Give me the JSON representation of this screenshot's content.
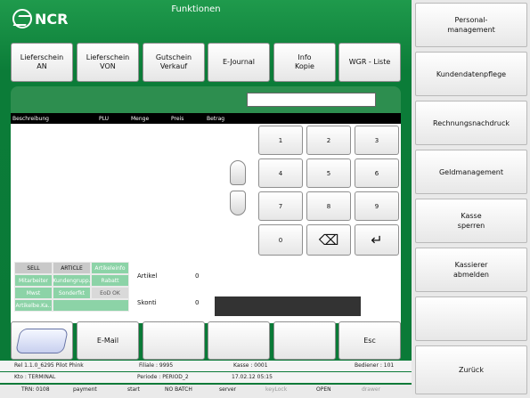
{
  "brand": "NCR",
  "title": "Funktionen",
  "function_buttons": [
    {
      "label": "Lieferschein\nAN"
    },
    {
      "label": "Lieferschein\nVON"
    },
    {
      "label": "Gutschein\nVerkauf"
    },
    {
      "label": "E-Journal"
    },
    {
      "label": "Info\nKopie"
    },
    {
      "label": "WGR - Liste"
    }
  ],
  "right_buttons": [
    {
      "label": "Personal-\nmanagement"
    },
    {
      "label": "Kundendatenpflege"
    },
    {
      "label": "Rechnungsnachdruck"
    },
    {
      "label": "Geldmanagement"
    },
    {
      "label": "Kasse\nsperren"
    },
    {
      "label": "Kassierer\nabmelden"
    },
    {
      "label": ""
    },
    {
      "label": "Zurück"
    }
  ],
  "input": {
    "value": ""
  },
  "columns": [
    "Beschreibung",
    "PLU",
    "Menge",
    "Preis",
    "Betrag"
  ],
  "numpad": [
    "1",
    "2",
    "3",
    "4",
    "5",
    "6",
    "7",
    "8",
    "9",
    "0",
    "⌫",
    "↵"
  ],
  "quick_buttons": [
    "SELL",
    "ARTICLE",
    "Artikeleinfo",
    "Mitarbeiter",
    "Kundengrupp.",
    "Rabatt",
    "Mwst",
    "Sonderfkt",
    "EoD OK",
    "Artikelbe.Ka.."
  ],
  "totals": {
    "articles_label": "Artikel",
    "articles_value": "0",
    "skonti_label": "Skonti",
    "skonti_value": "0"
  },
  "bottom_buttons": [
    "E-Mail",
    "Esc"
  ],
  "status": {
    "rel": "Rel 1.1.0_6295 Pilot Phink",
    "filiale": "Filiale : 9995",
    "kasse": "Kasse : 0001",
    "bediener": "Bediener : 101",
    "kto": "Kto : TERMINAL",
    "periode": "Periode : PERIOD_2",
    "datetime": "17.02.12 05:15",
    "trn": "TRN: 0108",
    "payment": "payment",
    "start": "start",
    "batch": "NO BATCH",
    "server": "server",
    "keylock": "keyLock",
    "open": "OPEN",
    "drawer": "drawer"
  },
  "colors": {
    "accent_green": "#0a7a37",
    "panel_gray": "#e9e9e9"
  }
}
